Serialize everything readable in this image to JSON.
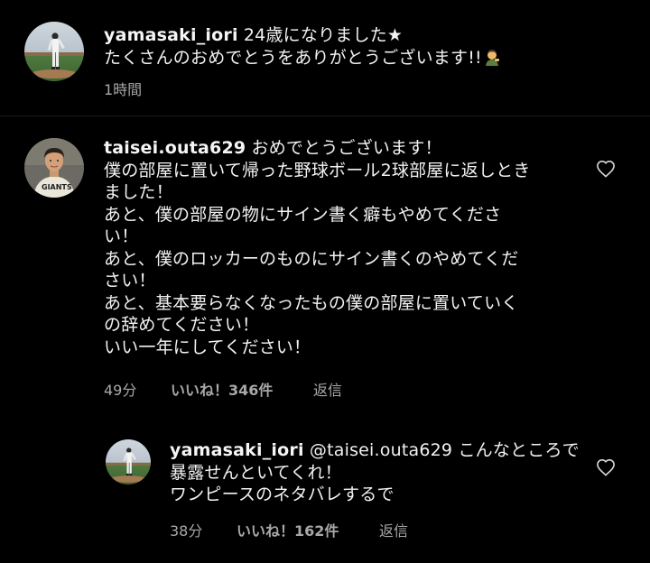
{
  "comments": [
    {
      "username": "yamasaki_iori",
      "body": " 24歳になりました★\nたくさんのおめでとうをありがとうございます!!",
      "time": "1時間"
    },
    {
      "username": "taisei.outa629",
      "body": " おめでとうございます！\n僕の部屋に置いて帰った野球ボール2球部屋に返しとき\nました！\nあと、僕の部屋の物にサイン書く癖もやめてくださ\nい！\nあと、僕のロッカーのものにサイン書くのやめてくだ\nさい！\nあと、基本要らなくなったもの僕の部屋に置いていく\nの辞めてください！\nいい一年にしてください！",
      "time": "49分",
      "likes": "いいね！346件",
      "reply": "返信"
    },
    {
      "username": "yamasaki_iori",
      "body": " @taisei.outa629 こんなところで\n暴露せんといてくれ！\nワンピースのネタバレするで",
      "time": "38分",
      "likes": "いいね！162件",
      "reply": "返信"
    }
  ],
  "colors": {
    "background": "#000000",
    "text": "#f2f2f2",
    "meta": "#a8a8a8",
    "divider": "#1c1c1c"
  },
  "icons": [
    "heart-outline-icon",
    "person-gesturing-emoji"
  ]
}
